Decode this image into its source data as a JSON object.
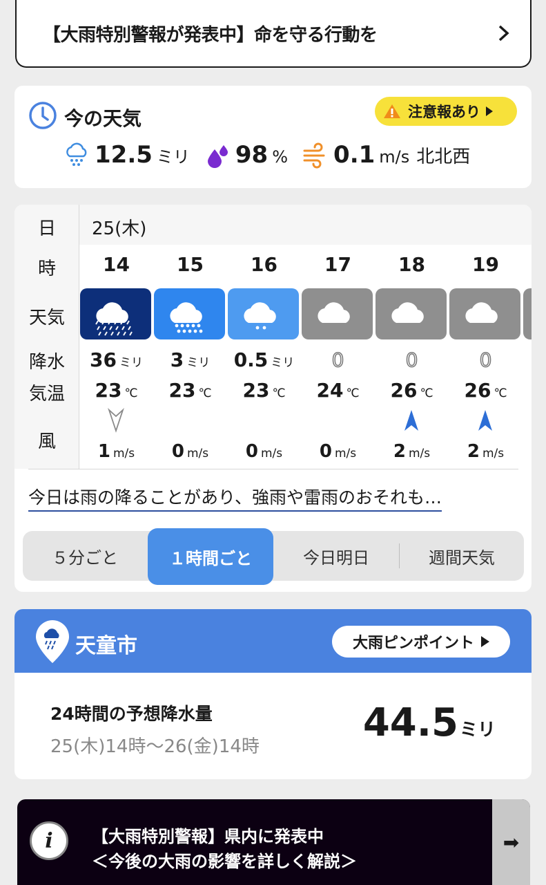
{
  "alert": {
    "text": "【大雨特別警報が発表中】命を守る行動を"
  },
  "now": {
    "title": "今の天気",
    "badge": "注意報あり",
    "precip": {
      "value": "12.5",
      "unit": "ミリ"
    },
    "humidity": {
      "value": "98",
      "unit": "%"
    },
    "wind": {
      "value": "0.1",
      "unit": "m/s",
      "direction": "北北西"
    }
  },
  "hourly": {
    "labels": {
      "day": "日",
      "hour": "時",
      "weather": "天気",
      "precip": "降水",
      "temp": "気温",
      "wind": "風"
    },
    "date": "25(木)",
    "hours": [
      {
        "hour": "14",
        "weather": "heavy-rain-thunder",
        "precip": "36",
        "precip_unit": "ミリ",
        "temp": "23",
        "temp_unit": "℃",
        "wind_dir": "down",
        "wind": "1",
        "wind_unit": "m/s",
        "color": "#0d2f7a"
      },
      {
        "hour": "15",
        "weather": "rain",
        "precip": "3",
        "precip_unit": "ミリ",
        "temp": "23",
        "temp_unit": "℃",
        "wind_dir": "none",
        "wind": "0",
        "wind_unit": "m/s",
        "color": "#2f86ee"
      },
      {
        "hour": "16",
        "weather": "light-rain",
        "precip": "0.5",
        "precip_unit": "ミリ",
        "temp": "23",
        "temp_unit": "℃",
        "wind_dir": "none",
        "wind": "0",
        "wind_unit": "m/s",
        "color": "#4e9bf0"
      },
      {
        "hour": "17",
        "weather": "cloudy",
        "precip": "0",
        "precip_unit": "",
        "temp": "24",
        "temp_unit": "℃",
        "wind_dir": "none",
        "wind": "0",
        "wind_unit": "m/s",
        "color": "#8f8f8f"
      },
      {
        "hour": "18",
        "weather": "cloudy",
        "precip": "0",
        "precip_unit": "",
        "temp": "26",
        "temp_unit": "℃",
        "wind_dir": "up",
        "wind": "2",
        "wind_unit": "m/s",
        "color": "#8f8f8f"
      },
      {
        "hour": "19",
        "weather": "cloudy",
        "precip": "0",
        "precip_unit": "",
        "temp": "26",
        "temp_unit": "℃",
        "wind_dir": "up",
        "wind": "2",
        "wind_unit": "m/s",
        "color": "#8f8f8f"
      }
    ],
    "summary": "今日は雨の降ることがあり、強雨や雷雨のおそれも…"
  },
  "tabs": [
    {
      "label": "５分ごと",
      "active": false
    },
    {
      "label": "１時間ごと",
      "active": true
    },
    {
      "label": "今日明日",
      "active": false
    },
    {
      "label": "週間天気",
      "active": false
    }
  ],
  "city": {
    "name": "天童市",
    "button": "大雨ピンポイント",
    "rain_title": "24時間の予想降水量",
    "rain_range": "25(木)14時～26(金)14時",
    "rain_total": "44.5",
    "rain_unit": "ミリ"
  },
  "info": {
    "line1": "【大雨特別警報】県内に発表中",
    "line2": "＜今後の大雨の影響を詳しく解説＞",
    "arrow": "➡"
  },
  "colors": {
    "accent": "#4a8fe7",
    "city_header": "#4a82df",
    "badge": "#f7e13a"
  }
}
